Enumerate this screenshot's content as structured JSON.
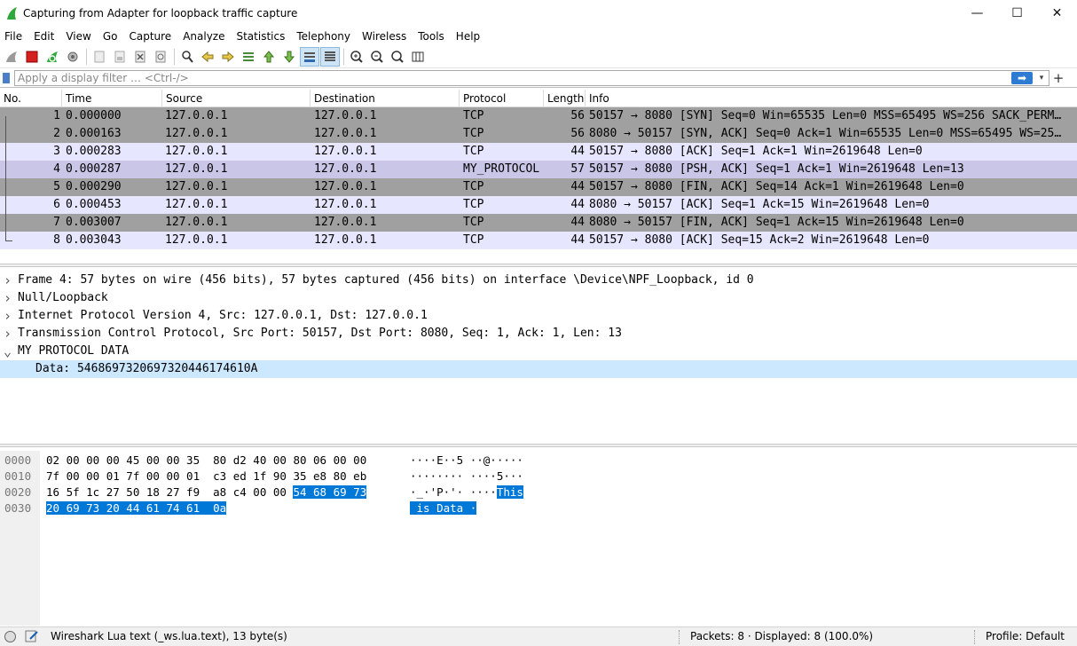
{
  "window": {
    "title": "Capturing from Adapter for loopback traffic capture",
    "minimize_glyph": "—",
    "maximize_glyph": "☐",
    "close_glyph": "✕"
  },
  "menu": [
    "File",
    "Edit",
    "View",
    "Go",
    "Capture",
    "Analyze",
    "Statistics",
    "Telephony",
    "Wireless",
    "Tools",
    "Help"
  ],
  "toolbar_icons": [
    "shark-fin-start-icon",
    "stop-capture-icon",
    "restart-capture-icon",
    "capture-options-icon",
    "open-file-icon",
    "save-file-icon",
    "close-file-icon",
    "reload-file-icon",
    "find-packet-icon",
    "go-back-icon",
    "go-forward-icon",
    "go-to-packet-icon",
    "first-packet-icon",
    "last-packet-icon",
    "auto-scroll-icon",
    "colorize-icon",
    "zoom-in-icon",
    "zoom-out-icon",
    "normal-size-icon",
    "resize-columns-icon"
  ],
  "filter": {
    "placeholder": "Apply a display filter … <Ctrl-/>",
    "apply_glyph": "➡",
    "dropdown_glyph": "▾",
    "add_glyph": "+"
  },
  "packet_list": {
    "columns": [
      "No.",
      "Time",
      "Source",
      "Destination",
      "Protocol",
      "Length",
      "Info"
    ],
    "rows": [
      {
        "no": "1",
        "time": "0.000000",
        "src": "127.0.0.1",
        "dst": "127.0.0.1",
        "proto": "TCP",
        "len": "56",
        "info": "50157 → 8080 [SYN] Seq=0 Win=65535 Len=0 MSS=65495 WS=256 SACK_PERM…",
        "style": "gray"
      },
      {
        "no": "2",
        "time": "0.000163",
        "src": "127.0.0.1",
        "dst": "127.0.0.1",
        "proto": "TCP",
        "len": "56",
        "info": "8080 → 50157 [SYN, ACK] Seq=0 Ack=1 Win=65535 Len=0 MSS=65495 WS=25…",
        "style": "gray"
      },
      {
        "no": "3",
        "time": "0.000283",
        "src": "127.0.0.1",
        "dst": "127.0.0.1",
        "proto": "TCP",
        "len": "44",
        "info": "50157 → 8080 [ACK] Seq=1 Ack=1 Win=2619648 Len=0",
        "style": "light"
      },
      {
        "no": "4",
        "time": "0.000287",
        "src": "127.0.0.1",
        "dst": "127.0.0.1",
        "proto": "MY_PROTOCOL",
        "len": "57",
        "info": "50157 → 8080 [PSH, ACK] Seq=1 Ack=1 Win=2619648 Len=13",
        "style": "selected"
      },
      {
        "no": "5",
        "time": "0.000290",
        "src": "127.0.0.1",
        "dst": "127.0.0.1",
        "proto": "TCP",
        "len": "44",
        "info": "50157 → 8080 [FIN, ACK] Seq=14 Ack=1 Win=2619648 Len=0",
        "style": "gray"
      },
      {
        "no": "6",
        "time": "0.000453",
        "src": "127.0.0.1",
        "dst": "127.0.0.1",
        "proto": "TCP",
        "len": "44",
        "info": "8080 → 50157 [ACK] Seq=1 Ack=15 Win=2619648 Len=0",
        "style": "light"
      },
      {
        "no": "7",
        "time": "0.003007",
        "src": "127.0.0.1",
        "dst": "127.0.0.1",
        "proto": "TCP",
        "len": "44",
        "info": "8080 → 50157 [FIN, ACK] Seq=1 Ack=15 Win=2619648 Len=0",
        "style": "gray"
      },
      {
        "no": "8",
        "time": "0.003043",
        "src": "127.0.0.1",
        "dst": "127.0.0.1",
        "proto": "TCP",
        "len": "44",
        "info": "50157 → 8080 [ACK] Seq=15 Ack=2 Win=2619648 Len=0",
        "style": "light"
      }
    ]
  },
  "details": [
    {
      "arrow": ">",
      "text": "Frame 4: 57 bytes on wire (456 bits), 57 bytes captured (456 bits) on interface \\Device\\NPF_Loopback, id 0",
      "indent": 0,
      "selected": false
    },
    {
      "arrow": ">",
      "text": "Null/Loopback",
      "indent": 0,
      "selected": false
    },
    {
      "arrow": ">",
      "text": "Internet Protocol Version 4, Src: 127.0.0.1, Dst: 127.0.0.1",
      "indent": 0,
      "selected": false
    },
    {
      "arrow": ">",
      "text": "Transmission Control Protocol, Src Port: 50157, Dst Port: 8080, Seq: 1, Ack: 1, Len: 13",
      "indent": 0,
      "selected": false
    },
    {
      "arrow": "v",
      "text": "MY PROTOCOL DATA",
      "indent": 0,
      "selected": false
    },
    {
      "arrow": "",
      "text": "Data: 5468697320697320446174610A",
      "indent": 1,
      "selected": true
    }
  ],
  "bytes": [
    {
      "offset": "0000",
      "hex_plain": "02 00 00 00 45 00 00 35  80 d2 40 00 80 06 00 00",
      "hex_hl": "",
      "ascii_plain": "····E··5 ··@·····",
      "ascii_hl": ""
    },
    {
      "offset": "0010",
      "hex_plain": "7f 00 00 01 7f 00 00 01  c3 ed 1f 90 35 e8 80 eb",
      "hex_hl": "",
      "ascii_plain": "········ ····5···",
      "ascii_hl": ""
    },
    {
      "offset": "0020",
      "hex_plain": "16 5f 1c 27 50 18 27 f9  a8 c4 00 00 ",
      "hex_hl": "54 68 69 73",
      "ascii_plain": "·_·'P·'· ····",
      "ascii_hl": "This"
    },
    {
      "offset": "0030",
      "hex_plain": "",
      "hex_hl": "20 69 73 20 44 61 74 61  0a",
      "ascii_plain": "",
      "ascii_hl": " is Data ·"
    }
  ],
  "status": {
    "field": "Wireshark Lua text (_ws.lua.text), 13 byte(s)",
    "packets": "Packets: 8 · Displayed: 8 (100.0%)",
    "profile": "Profile: Default"
  },
  "colors": {
    "gray_row": "#a0a0a0",
    "light_row": "#e7e6ff",
    "selected_row": "#c9c6e8",
    "highlight": "#0078d7",
    "detail_selected": "#cce8ff"
  }
}
